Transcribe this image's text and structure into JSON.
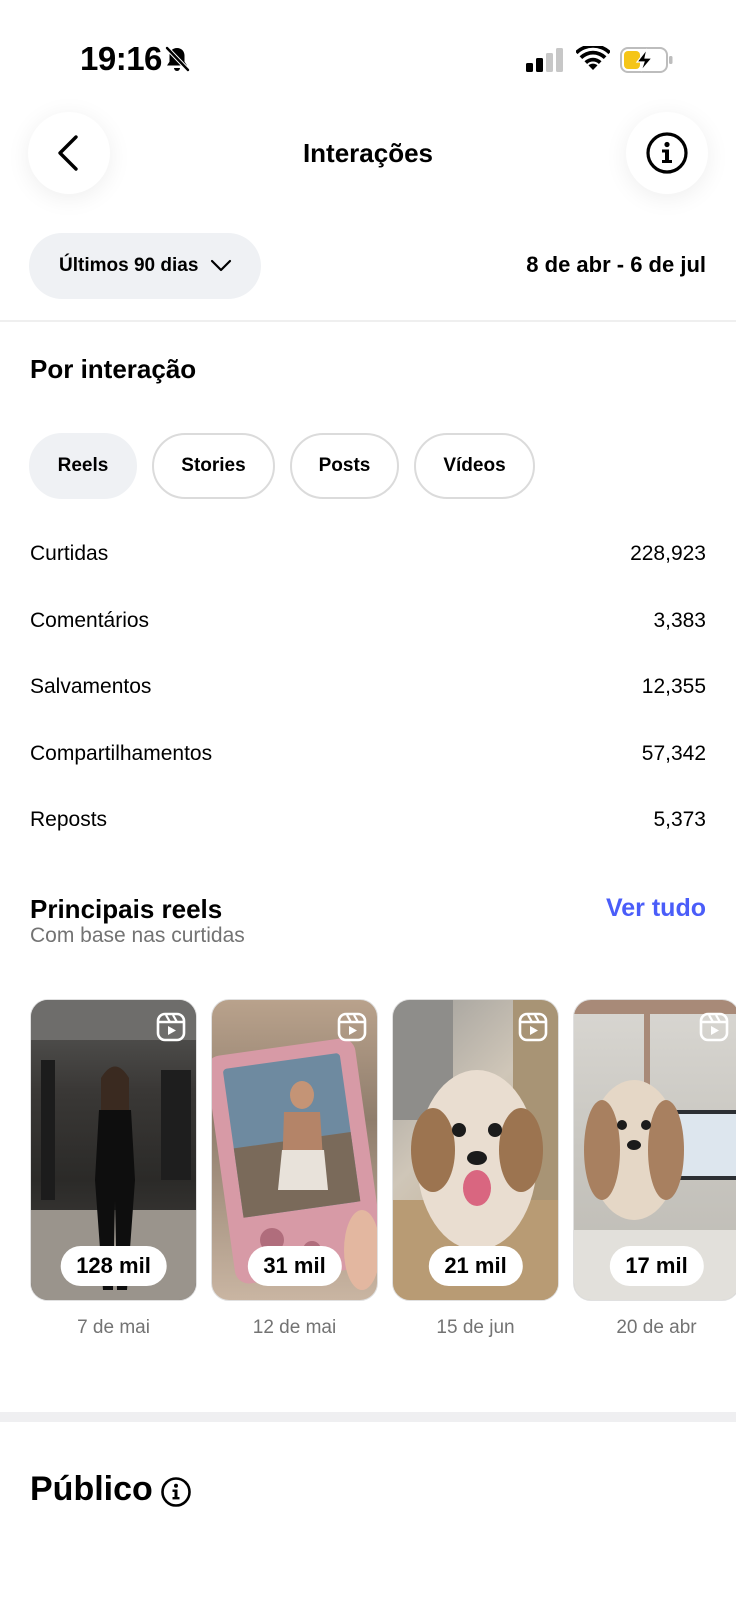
{
  "status_bar": {
    "time": "19:16"
  },
  "header": {
    "title": "Interações"
  },
  "filter": {
    "period_label": "Últimos 90 dias",
    "date_range": "8 de abr - 6 de jul"
  },
  "by_interaction": {
    "title": "Por interação",
    "tabs": [
      {
        "label": "Reels",
        "active": true
      },
      {
        "label": "Stories",
        "active": false
      },
      {
        "label": "Posts",
        "active": false
      },
      {
        "label": "Vídeos",
        "active": false
      }
    ],
    "metrics": [
      {
        "label": "Curtidas",
        "value": "228,923"
      },
      {
        "label": "Comentários",
        "value": "3,383"
      },
      {
        "label": "Salvamentos",
        "value": "12,355"
      },
      {
        "label": "Compartilhamentos",
        "value": "57,342"
      },
      {
        "label": "Reposts",
        "value": "5,373"
      }
    ]
  },
  "top_reels": {
    "title": "Principais reels",
    "subtitle": "Com base nas curtidas",
    "see_all": "Ver tudo",
    "items": [
      {
        "count": "128 mil",
        "date": "7 de mai"
      },
      {
        "count": "31 mil",
        "date": "12 de mai"
      },
      {
        "count": "21 mil",
        "date": "15 de jun"
      },
      {
        "count": "17 mil",
        "date": "20 de abr"
      }
    ]
  },
  "audience": {
    "title": "Público"
  },
  "colors": {
    "accent": "#4a5df9",
    "chip_bg": "#eff1f4",
    "muted_text": "#737373",
    "battery_fill": "#f5c518"
  }
}
